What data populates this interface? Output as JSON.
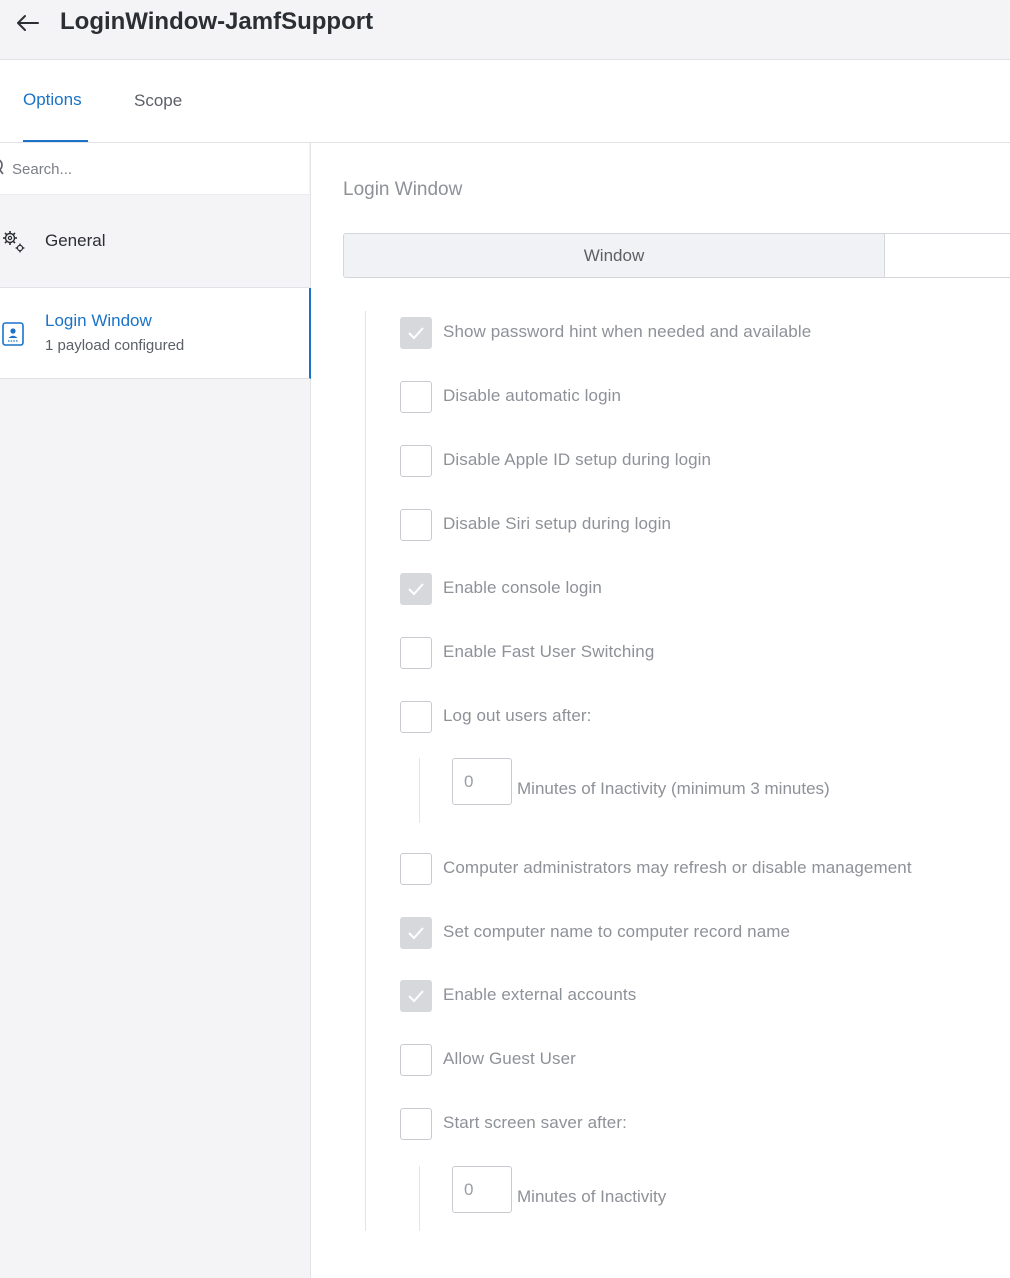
{
  "header": {
    "title": "LoginWindow-JamfSupport",
    "back_icon": "arrow-left-icon"
  },
  "tabs": [
    {
      "label": "Options",
      "active": true
    },
    {
      "label": "Scope",
      "active": false
    }
  ],
  "sidebar": {
    "search_placeholder": "Search...",
    "items": [
      {
        "label": "General",
        "sub": "",
        "icon": "gears-icon",
        "selected": false
      },
      {
        "label": "Login Window",
        "sub": "1 payload configured",
        "icon": "login-window-icon",
        "selected": true
      }
    ]
  },
  "main": {
    "section_title": "Login Window",
    "segments": [
      {
        "label": "Window",
        "active": true
      },
      {
        "label": "",
        "active": false
      }
    ],
    "options": [
      {
        "label": "Show password hint when needed and available",
        "checked": true
      },
      {
        "label": "Disable automatic login",
        "checked": false
      },
      {
        "label": "Disable Apple ID setup during login",
        "checked": false
      },
      {
        "label": "Disable Siri setup during login",
        "checked": false
      },
      {
        "label": "Enable console login",
        "checked": true
      },
      {
        "label": "Enable Fast User Switching",
        "checked": false
      },
      {
        "label": "Log out users after:",
        "checked": false
      },
      {
        "label": "Computer administrators may refresh or disable management",
        "checked": false
      },
      {
        "label": "Set computer name to computer record name",
        "checked": true
      },
      {
        "label": "Enable external accounts",
        "checked": true
      },
      {
        "label": "Allow Guest User",
        "checked": false
      },
      {
        "label": "Start screen saver after:",
        "checked": false
      }
    ],
    "logout_minutes": {
      "value": "0",
      "label": "Minutes of Inactivity (minimum 3 minutes)"
    },
    "screensaver_minutes": {
      "value": "0",
      "label": "Minutes of Inactivity"
    }
  },
  "colors": {
    "accent": "#1a73c8",
    "muted_text": "#8e9197",
    "checked_box": "#d7d8dc"
  }
}
